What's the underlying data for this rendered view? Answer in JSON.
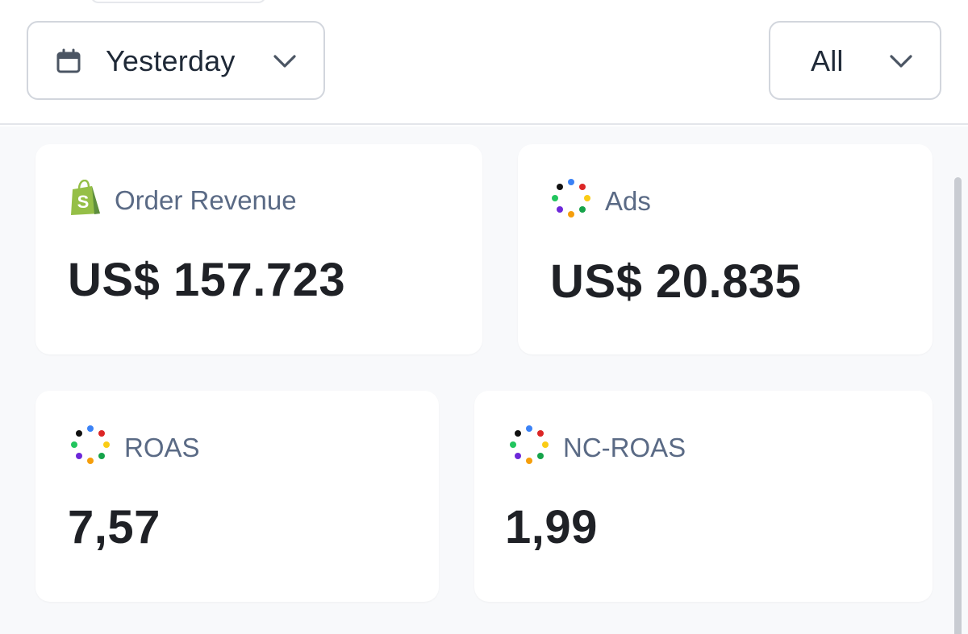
{
  "filters": {
    "date_range": {
      "label": "Yesterday",
      "icon": "calendar-icon"
    },
    "scope": {
      "label": "All"
    }
  },
  "metrics": [
    {
      "title": "Order Revenue",
      "value": "US$ 157.723",
      "icon": "shopify-icon"
    },
    {
      "title": "Ads",
      "value": "US$ 20.835",
      "icon": "multi-color-dots-icon"
    },
    {
      "title": "ROAS",
      "value": "7,57",
      "icon": "multi-color-dots-icon"
    },
    {
      "title": "NC-ROAS",
      "value": "1,99",
      "icon": "multi-color-dots-icon"
    }
  ],
  "colors": {
    "dots": [
      "#3b82f6",
      "#dc2626",
      "#facc15",
      "#16a34a",
      "#f59e0b",
      "#6d28d9",
      "#22c55e",
      "#111111"
    ],
    "shopify": "#95bf47",
    "label": "#5a6a85",
    "value": "#1f2126"
  }
}
